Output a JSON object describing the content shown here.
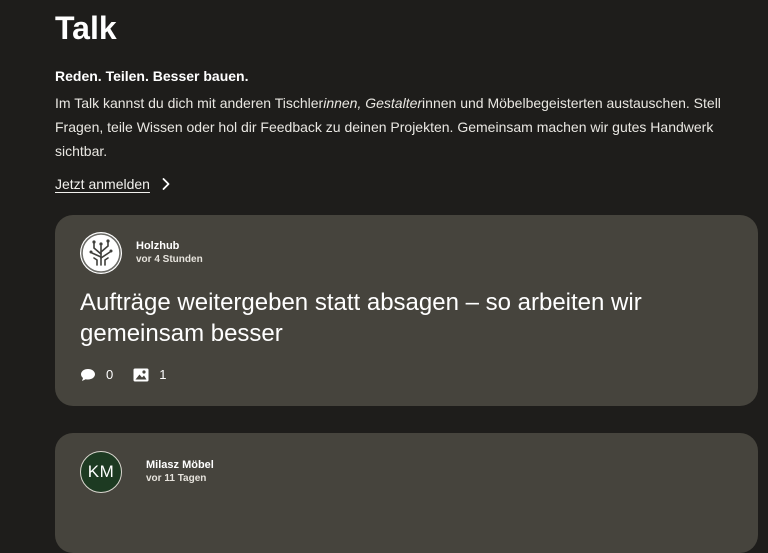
{
  "header": {
    "title": "Talk",
    "tagline": "Reden. Teilen. Besser bauen.",
    "intro_before_em": "Im Talk kannst du dich mit anderen Tischler",
    "intro_em": "innen, Gestalter",
    "intro_after_em": "innen und Möbelbegeisterten austauschen. Stell Fragen, teile Wissen oder hol dir Feedback zu deinen Projekten. Gemeinsam machen wir gutes Handwerk sichtbar.",
    "login_label": "Jetzt anmelden"
  },
  "posts": [
    {
      "author": "Holzhub",
      "time": "vor 4 Stunden",
      "avatar_icon": "tree-logo-icon",
      "title": "Aufträge weitergeben statt absagen – so arbeiten wir gemeinsam besser",
      "comments": "0",
      "images": "1"
    },
    {
      "author": "Milasz Möbel",
      "time": "vor 11 Tagen",
      "avatar_initials": "KM",
      "title": ""
    }
  ],
  "colors": {
    "background": "#1e1d1b",
    "card": "#46443d",
    "avatar_green": "#1d3a22"
  }
}
